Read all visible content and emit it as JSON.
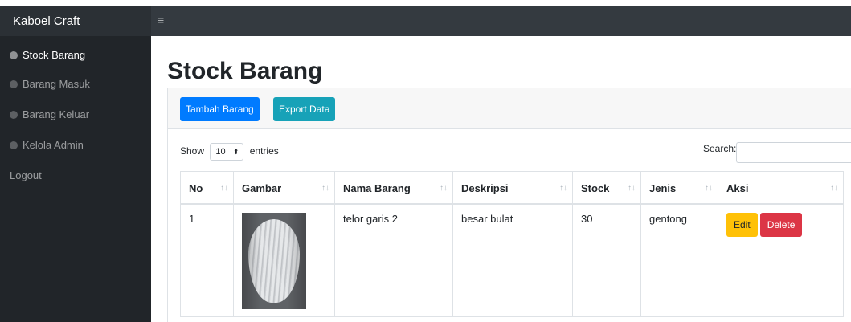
{
  "header": {
    "brand": "Kaboel Craft",
    "toggle_icon": "≡"
  },
  "sidebar": {
    "items": [
      {
        "label": "Stock Barang",
        "icon": "dashboard-icon"
      },
      {
        "label": "Barang Masuk",
        "icon": "dashboard-icon"
      },
      {
        "label": "Barang Keluar",
        "icon": "dashboard-icon"
      },
      {
        "label": "Kelola Admin",
        "icon": "dashboard-icon"
      },
      {
        "label": "Logout"
      }
    ]
  },
  "main": {
    "title": "Stock Barang",
    "buttons": {
      "add": "Tambah Barang",
      "export": "Export Data"
    },
    "length": {
      "show": "Show",
      "value": "10",
      "entries": "entries"
    },
    "search": {
      "label": "Search:",
      "value": ""
    },
    "table": {
      "columns": [
        "No",
        "Gambar",
        "Nama Barang",
        "Deskripsi",
        "Stock",
        "Jenis",
        "Aksi"
      ],
      "sort_glyph": "↑↓",
      "rows": [
        {
          "no": "1",
          "image": "vase-photo",
          "nama": "telor garis 2",
          "deskripsi": "besar bulat",
          "stock": "30",
          "jenis": "gentong"
        }
      ],
      "actions": {
        "edit": "Edit",
        "delete": "Delete"
      }
    }
  },
  "colors": {
    "primary": "#007bff",
    "info": "#17a2b8",
    "warning": "#ffc107",
    "danger": "#dc3545",
    "sidebar": "#212529",
    "topbar": "#343a40"
  }
}
